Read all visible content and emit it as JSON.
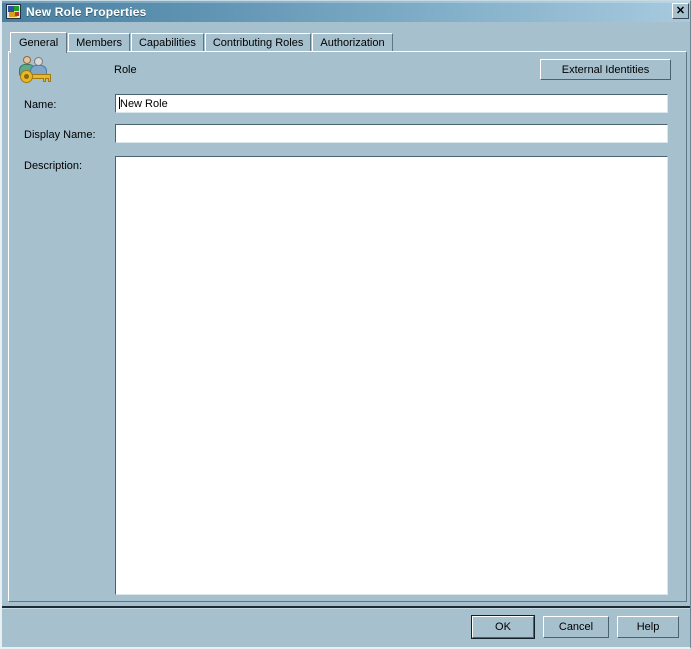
{
  "window": {
    "title": "New Role Properties",
    "icon": "role-properties-icon",
    "close_label": "✕",
    "bg_color": "#a6c0ce",
    "titlebar_color_left": "#4a7fa0",
    "titlebar_color_right": "#a8cade"
  },
  "tabs": [
    {
      "label": "General",
      "active": true
    },
    {
      "label": "Members",
      "active": false
    },
    {
      "label": "Capabilities",
      "active": false
    },
    {
      "label": "Contributing Roles",
      "active": false
    },
    {
      "label": "Authorization",
      "active": false
    }
  ],
  "general": {
    "object_type_label": "Role",
    "object_icon": "role-users-key-icon",
    "external_identities_label": "External Identities",
    "fields": {
      "name": {
        "label": "Name:",
        "value": "New Role",
        "placeholder": ""
      },
      "display_name": {
        "label": "Display Name:",
        "value": "",
        "placeholder": ""
      },
      "description": {
        "label": "Description:",
        "value": "",
        "placeholder": ""
      }
    }
  },
  "footer": {
    "ok_label": "OK",
    "cancel_label": "Cancel",
    "help_label": "Help"
  }
}
